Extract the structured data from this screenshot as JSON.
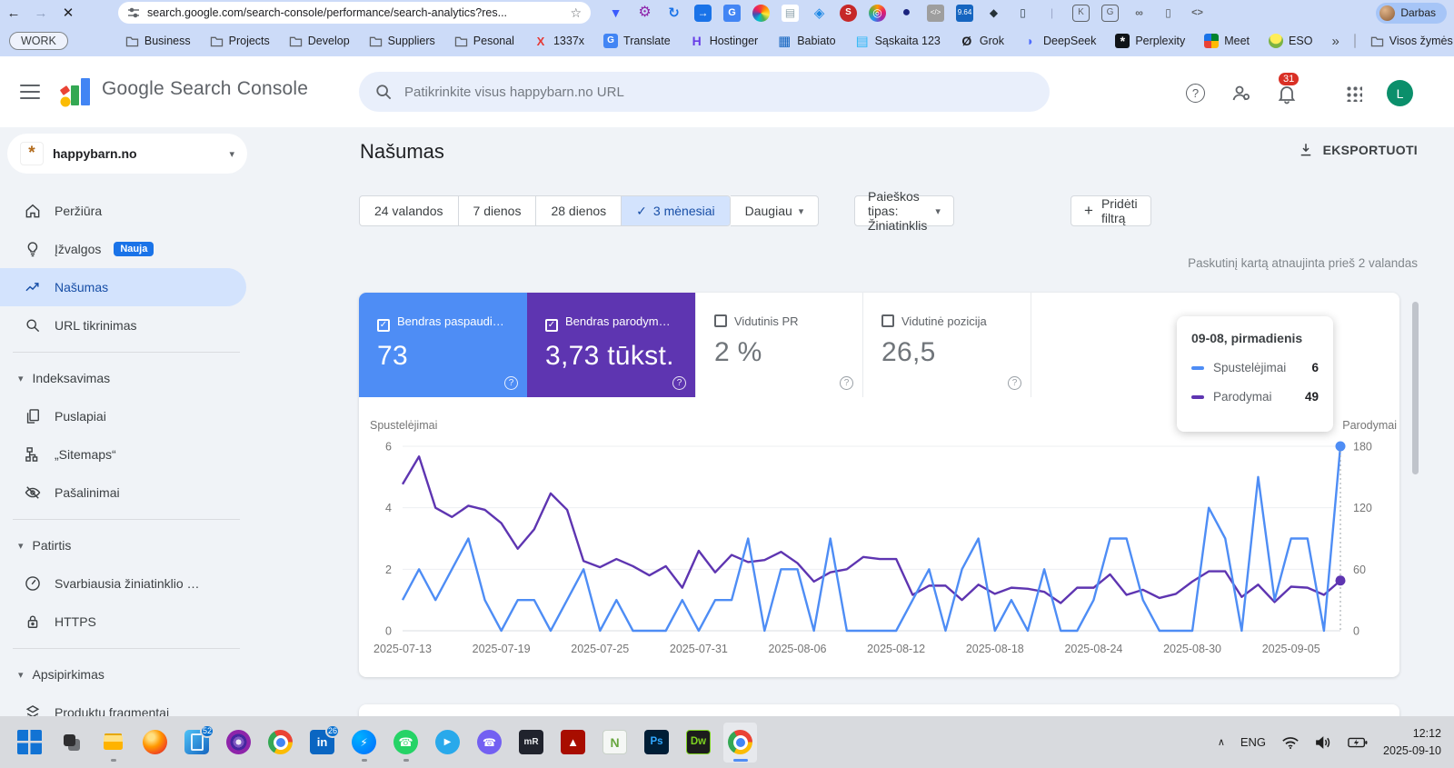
{
  "browser": {
    "back": "←",
    "forward": "→",
    "close": "✕",
    "url": "search.google.com/search-console/performance/search-analytics?res...",
    "star": "☆",
    "profile_label": "Darbas",
    "extensions": [
      {
        "name": "map-pin-extension-icon",
        "glyph": "▼",
        "style": "color:#3b5bfd;font-size:14px"
      },
      {
        "name": "gear-extension-icon",
        "glyph": "⚙",
        "style": "color:#8e24aa;font-size:16px"
      },
      {
        "name": "refresh-extension-icon",
        "glyph": "↻",
        "style": "color:#1a73e8;font-weight:700;font-size:15px"
      },
      {
        "name": "tab-arrow-extension-icon",
        "glyph": "→",
        "style": "background:#1a73e8;color:#fff;border-radius:4px"
      },
      {
        "name": "translate-extension-icon",
        "glyph": "G",
        "style": "background:#4285f4;color:#fff;border-radius:3px;font-size:11px;font-weight:700"
      },
      {
        "name": "color-wheel-extension-icon",
        "glyph": "",
        "style": "background:conic-gradient(#f44336,#ff9800,#ffeb3b,#4caf50,#00bcd4,#3f51b5,#e91e63,#f44336);border-radius:50%"
      },
      {
        "name": "notes-extension-icon",
        "glyph": "▤",
        "style": "color:#90a4ae;background:#fff;border-radius:3px"
      },
      {
        "name": "tag-extension-icon",
        "glyph": "◈",
        "style": "color:#1e88e5;font-size:15px"
      },
      {
        "name": "seo-extension-icon",
        "glyph": "S",
        "style": "background:#c62828;color:#fff;border-radius:50%;font-weight:700;font-size:10px"
      },
      {
        "name": "lens-extension-icon",
        "glyph": "◎",
        "style": "background:conic-gradient(#ff9800,#e91e63,#9c27b0,#2196f3,#4caf50,#ff9800);color:#fff;border-radius:50%"
      },
      {
        "name": "sphere-extension-icon",
        "glyph": "●",
        "style": "color:#1a237e;font-size:16px"
      },
      {
        "name": "code-extension-icon",
        "glyph": "</>",
        "style": "background:#9e9e9e;color:#fff;border-radius:3px;font-size:8px"
      },
      {
        "name": "seoquake-extension-icon",
        "glyph": "9.64",
        "style": "background:#1565c0;color:#fff;border-radius:3px;font-size:8px"
      },
      {
        "name": "pen-extension-icon",
        "glyph": "◆",
        "style": "color:#263238;font-size:12px"
      },
      {
        "name": "clipboard-extension-icon",
        "glyph": "▯",
        "style": "color:#37474f;font-weight:700"
      },
      {
        "name": "toolbar-separator",
        "glyph": "|",
        "style": "color:#9aa6c8"
      },
      {
        "name": "key-extension-icon",
        "glyph": "K",
        "style": "color:#5f6368;border:1.5px solid #5f6368;border-radius:4px;font-size:10px"
      },
      {
        "name": "page-translate-extension-icon",
        "glyph": "G",
        "style": "color:#5f6368;border:1.5px solid #5f6368;border-radius:4px;font-size:10px"
      },
      {
        "name": "link-extension-icon",
        "glyph": "∞",
        "style": "color:#5f6368;font-weight:700"
      },
      {
        "name": "trash-extension-icon",
        "glyph": "▯",
        "style": "color:#5f6368"
      },
      {
        "name": "brackets-extension-icon",
        "glyph": "<>",
        "style": "color:#5f6368;font-size:11px;font-weight:700"
      }
    ],
    "bookmarks": {
      "work_group": "WORK",
      "items": [
        {
          "label": "Business",
          "kind": "folder"
        },
        {
          "label": "Projects",
          "kind": "folder"
        },
        {
          "label": "Develop",
          "kind": "folder"
        },
        {
          "label": "Suppliers",
          "kind": "folder"
        },
        {
          "label": "Pesonal",
          "kind": "folder"
        },
        {
          "label": "1337x",
          "kind": "site",
          "letter": "X",
          "style": "color:#e53935;font-weight:800;font-size:13px"
        },
        {
          "label": "Translate",
          "kind": "site",
          "letter": "G",
          "style": "background:#4285f4;color:#fff;border-radius:3px;font-size:10px;font-weight:700"
        },
        {
          "label": "Hostinger",
          "kind": "site",
          "letter": "H",
          "style": "color:#673de6;font-weight:800;font-size:14px"
        },
        {
          "label": "Babiato",
          "kind": "site",
          "letter": "▦",
          "style": "color:#1565c0;font-size:15px"
        },
        {
          "label": "Sąskaita 123",
          "kind": "site",
          "letter": "▤",
          "style": "color:#29b6f6;font-size:15px"
        },
        {
          "label": "Grok",
          "kind": "site",
          "letter": "Ø",
          "style": "color:#202124;font-weight:700;font-size:14px"
        },
        {
          "label": "DeepSeek",
          "kind": "site",
          "letter": "◗",
          "style": "color:#4d6bfe;font-weight:700;font-size:14px"
        },
        {
          "label": "Perplexity",
          "kind": "site",
          "letter": "*",
          "style": "background:#101418;color:#fff;border-radius:3px;font-weight:700;font-size:14px"
        },
        {
          "label": "Meet",
          "kind": "site",
          "letter": "",
          "style": "background:conic-gradient(#00832d 0 25%,#ffba00 0 50%,#ea4335 0 75%,#1a73e8 0);border-radius:3px"
        },
        {
          "label": "ESO",
          "kind": "site",
          "letter": "",
          "style": "background:radial-gradient(circle at 50% 30%,#ffee58 0 45%,#7cb342 50%);border-radius:50%"
        }
      ],
      "overflow": "»",
      "all_bookmarks": "Visos žymės"
    }
  },
  "console": {
    "header": {
      "product": "Google Search Console",
      "search_placeholder": "Patikrinkite visus happybarn.no URL",
      "help_glyph": "?",
      "notification_count": "31",
      "avatar_letter": "L"
    },
    "property": {
      "name": "happybarn.no",
      "caret": "▾"
    },
    "sidebar": {
      "items": [
        {
          "label": "Peržiūra"
        },
        {
          "label": "Įžvalgos",
          "badge": "Nauja"
        },
        {
          "label": "Našumas"
        },
        {
          "label": "URL tikrinimas"
        },
        {
          "label": "Indeksavimas",
          "caret": "▾"
        },
        {
          "label": "Puslapiai"
        },
        {
          "label": "„Sitemaps“"
        },
        {
          "label": "Pašalinimai"
        },
        {
          "label": "Patirtis",
          "caret": "▾"
        },
        {
          "label": "Svarbiausia žiniatinklio …"
        },
        {
          "label": "HTTPS"
        },
        {
          "label": "Apsipirkimas",
          "caret": "▾"
        },
        {
          "label": "Produktų fragmentai"
        }
      ]
    },
    "page": {
      "title": "Našumas",
      "export_label": "EKSPORTUOTI",
      "date_ranges": [
        {
          "label": "24 valandos",
          "cls": "",
          "check": ""
        },
        {
          "label": "7 dienos",
          "cls": "",
          "check": ""
        },
        {
          "label": "28 dienos",
          "cls": "",
          "check": ""
        },
        {
          "label": "3 mėnesiai",
          "cls": "seg-sel",
          "check": "✓"
        }
      ],
      "more_label": "Daugiau",
      "more_caret": "▾",
      "search_type_label": "Paieškos tipas: Žiniatinklis",
      "search_type_caret": "▾",
      "add_filter_plus": "+",
      "add_filter_label": "Pridėti filtrą",
      "updated_note": "Paskutinį kartą atnaujinta prieš 2 valandas",
      "help_glyph": "?",
      "cards": [
        {
          "label": "Bendras paspaudi…",
          "value": "73",
          "check": "✓"
        },
        {
          "label": "Bendras parodym…",
          "value": "3,73 tūkst.",
          "check": "✓"
        },
        {
          "label": "Vidutinis PR",
          "value": "2 %",
          "check": ""
        },
        {
          "label": "Vidutinė pozicija",
          "value": "26,5",
          "check": ""
        }
      ],
      "tooltip": {
        "title": "09-08, pirmadienis",
        "rows": [
          {
            "label": "Spustelėjimai",
            "value": "6",
            "dash": "background:#4e8df5"
          },
          {
            "label": "Parodymai",
            "value": "49",
            "dash": "background:#5e35b1"
          }
        ]
      }
    }
  },
  "chart_data": {
    "type": "line",
    "start_date": "2025-07-13",
    "end_date": "2025-09-08",
    "x_ticks": [
      "2025-07-13",
      "2025-07-19",
      "2025-07-25",
      "2025-07-31",
      "2025-08-06",
      "2025-08-12",
      "2025-08-18",
      "2025-08-24",
      "2025-08-30",
      "2025-09-05"
    ],
    "x_tick_days": [
      0,
      6,
      12,
      18,
      24,
      30,
      36,
      42,
      48,
      54
    ],
    "ylabel_left": "Spustelėjimai",
    "ylabel_right": "Parodymai",
    "ylim_left": [
      0,
      6
    ],
    "ylim_right": [
      0,
      180
    ],
    "yticks_left": [
      0,
      2,
      4,
      6
    ],
    "yticks_right": [
      0,
      60,
      120,
      180
    ],
    "grid": true,
    "legend_position": "none",
    "series": [
      {
        "name": "Spustelėjimai",
        "axis": "left",
        "color": "#4e8df5",
        "values": [
          1,
          2,
          1,
          2,
          3,
          1,
          0,
          1,
          1,
          0,
          1,
          2,
          0,
          1,
          0,
          0,
          0,
          1,
          0,
          1,
          1,
          3,
          0,
          2,
          2,
          0,
          3,
          0,
          0,
          0,
          0,
          1,
          2,
          0,
          2,
          3,
          0,
          1,
          0,
          2,
          0,
          0,
          1,
          3,
          3,
          1,
          0,
          0,
          0,
          4,
          3,
          0,
          5,
          1,
          3,
          3,
          0,
          6
        ]
      },
      {
        "name": "Parodymai",
        "axis": "right",
        "color": "#5e35b1",
        "values": [
          143,
          170,
          120,
          111,
          122,
          118,
          105,
          80,
          99,
          134,
          118,
          68,
          62,
          70,
          63,
          54,
          63,
          42,
          78,
          57,
          74,
          67,
          69,
          77,
          66,
          48,
          57,
          60,
          72,
          70,
          70,
          35,
          44,
          44,
          30,
          45,
          36,
          42,
          41,
          38,
          27,
          42,
          42,
          55,
          35,
          40,
          32,
          36,
          48,
          58,
          58,
          33,
          45,
          28,
          43,
          42,
          35,
          49
        ]
      }
    ],
    "hover": {
      "date": "09-08",
      "day_index": 57,
      "clicks": 6,
      "impressions": 49
    },
    "totals": {
      "clicks": "73",
      "impressions": "3,73 tūkst.",
      "avg_ctr": "2 %",
      "avg_position": "26,5"
    }
  },
  "taskbar": {
    "items": [
      {
        "name": "start-button",
        "icls": "ic ic-win",
        "wcls": ""
      },
      {
        "name": "task-view-button",
        "icls": "ic ic-taskview",
        "wcls": ""
      },
      {
        "name": "file-explorer-icon",
        "icls": "ic ic-explorer",
        "wcls": "has-dot"
      },
      {
        "name": "firefox-icon",
        "icls": "ic ic-firefox",
        "wcls": ""
      },
      {
        "name": "phone-link-icon",
        "icls": "ic ic-phonelink",
        "wcls": "",
        "badge": "52"
      },
      {
        "name": "tor-browser-icon",
        "icls": "ic ic-tor",
        "wcls": ""
      },
      {
        "name": "chrome-icon",
        "icls": "ic ic-chrome",
        "wcls": ""
      },
      {
        "name": "linkedin-icon",
        "icls": "ic ic-linkedin",
        "wcls": "",
        "glyph": "in",
        "badge": "26"
      },
      {
        "name": "messenger-icon",
        "icls": "ic ic-messenger",
        "wcls": "has-dot",
        "glyph": "⚡"
      },
      {
        "name": "whatsapp-icon",
        "icls": "ic ic-whatsapp",
        "wcls": "has-dot",
        "glyph": "☎"
      },
      {
        "name": "telegram-icon",
        "icls": "ic ic-telegram",
        "wcls": "",
        "glyph": "▶"
      },
      {
        "name": "viber-icon",
        "icls": "ic ic-viber",
        "wcls": "",
        "glyph": "☎"
      },
      {
        "name": "mremoteng-icon",
        "icls": "ic ic-mremote",
        "wcls": "",
        "glyph": "mR"
      },
      {
        "name": "acrobat-icon",
        "icls": "ic ic-acrobat",
        "wcls": "",
        "glyph": "▲"
      },
      {
        "name": "notepad-plus-plus-icon",
        "icls": "ic ic-npp",
        "wcls": "",
        "glyph": "N"
      },
      {
        "name": "photoshop-icon",
        "icls": "ic ic-ps",
        "wcls": "",
        "glyph": "Ps"
      },
      {
        "name": "dreamweaver-icon",
        "icls": "ic ic-dw",
        "wcls": "",
        "glyph": "Dw"
      },
      {
        "name": "chrome-active-icon",
        "icls": "ic ic-chrome",
        "wcls": "active"
      }
    ],
    "tray": {
      "chevron": "∧",
      "lang": "ENG",
      "time": "12:12",
      "date": "2025-09-10"
    }
  }
}
